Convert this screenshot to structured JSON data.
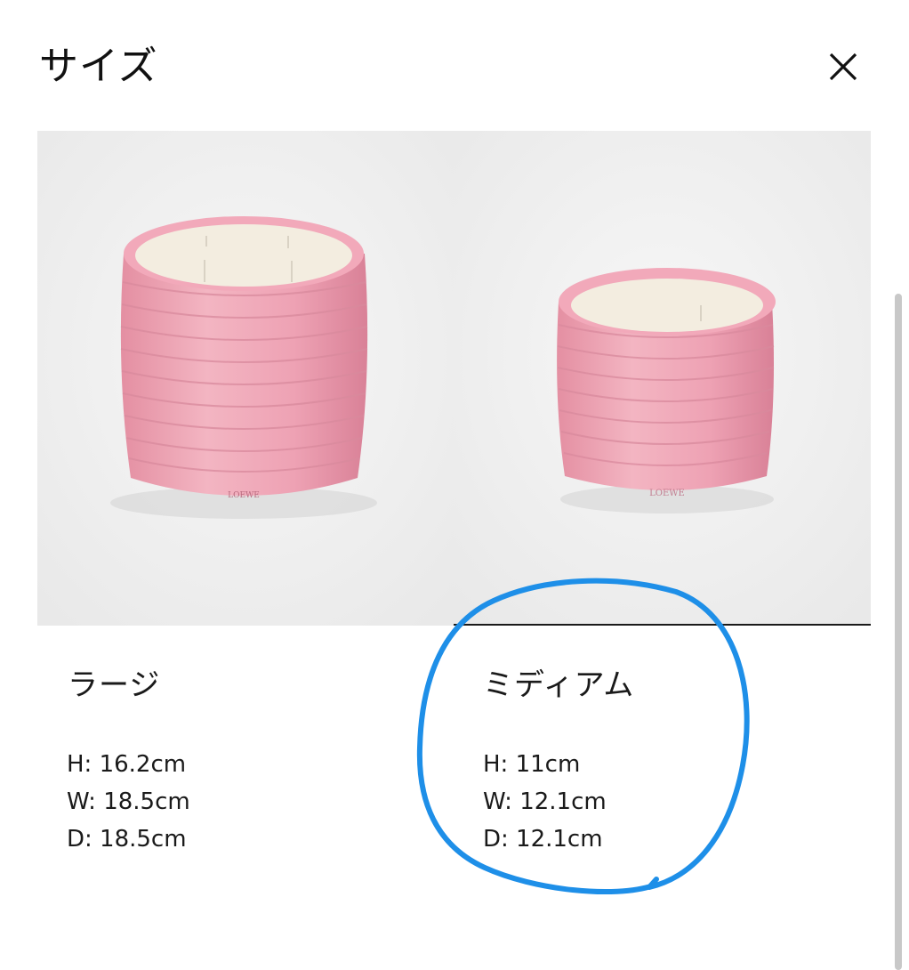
{
  "header": {
    "title": "サイズ",
    "close_icon": "close-icon"
  },
  "products": [
    {
      "name": "ラージ",
      "brand_mark": "LOEWE",
      "dimensions": {
        "h": "H: 16.2cm",
        "w": "W: 18.5cm",
        "d": "D: 18.5cm"
      },
      "selected": false
    },
    {
      "name": "ミディアム",
      "brand_mark": "LOEWE",
      "dimensions": {
        "h": "H: 11cm",
        "w": "W: 12.1cm",
        "d": "D: 12.1cm"
      },
      "selected": true
    }
  ],
  "colors": {
    "candle_pink": "#f0a9b8",
    "wax": "#f3ede0",
    "panel_bg": "#efefef",
    "annotation_blue": "#1e8fe8"
  }
}
